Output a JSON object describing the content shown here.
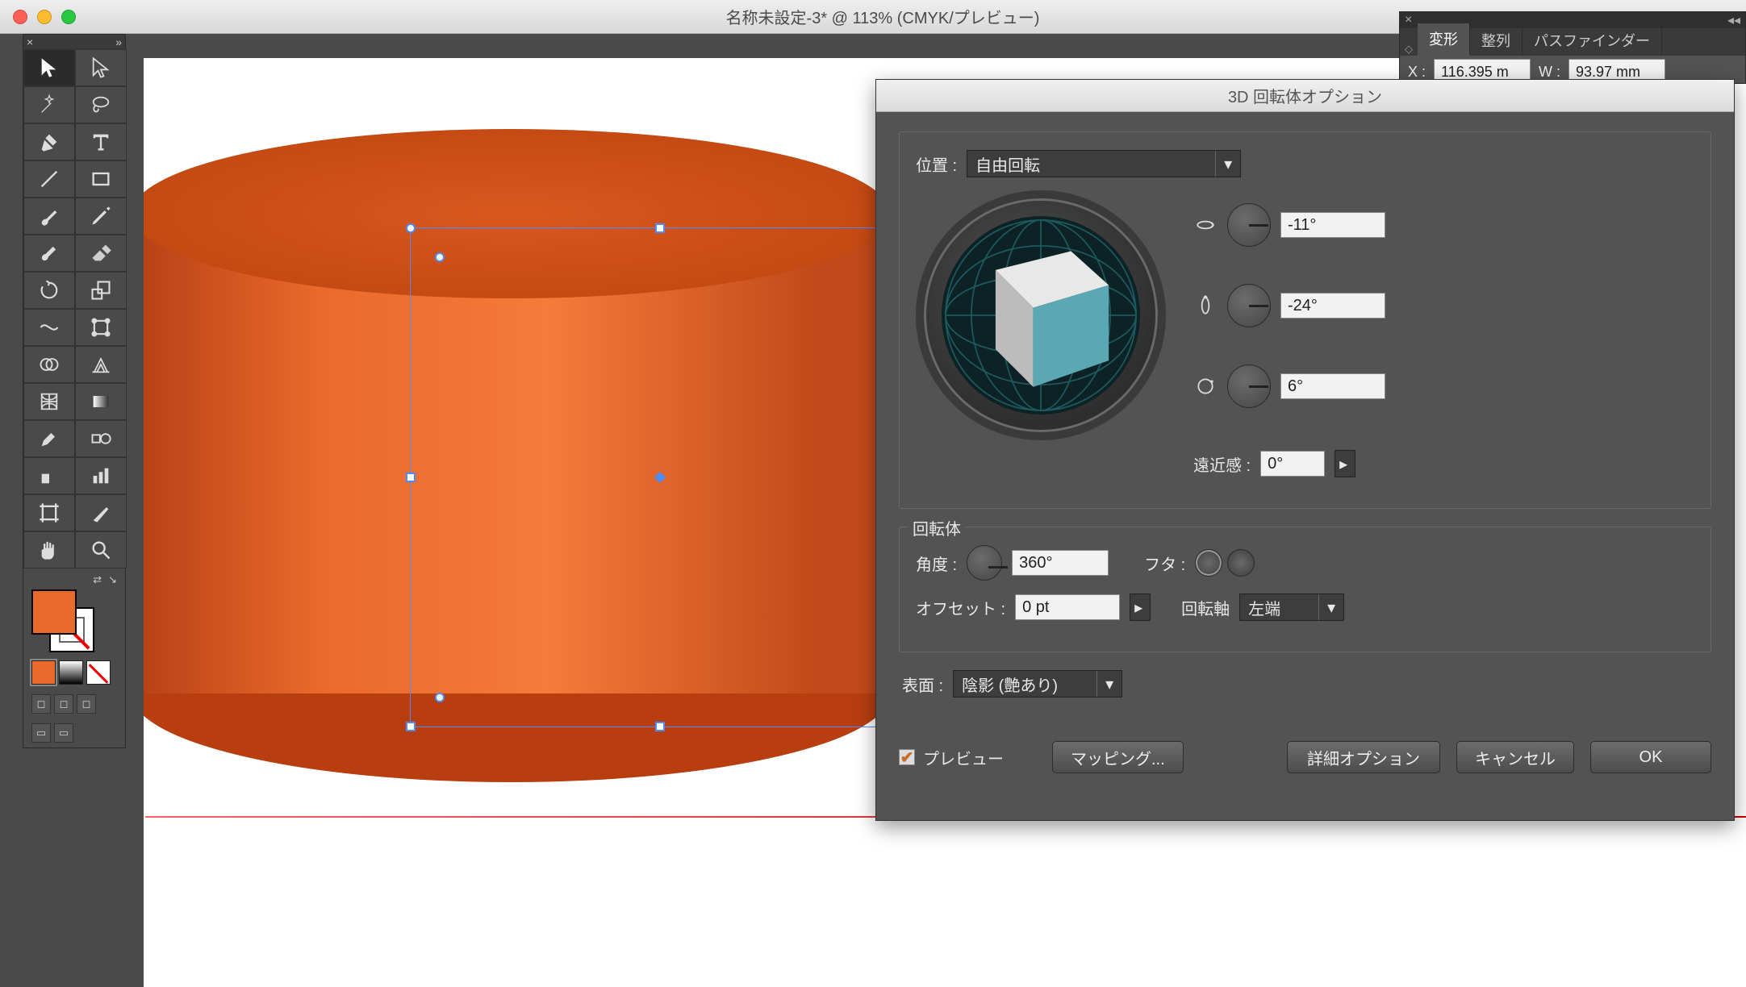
{
  "window": {
    "title": "名称未設定-3* @ 113% (CMYK/プレビュー)"
  },
  "palette": {
    "tabs": {
      "transform": "変形",
      "align": "整列",
      "pathfinder": "パスファインダー"
    },
    "x_label": "X :",
    "x_value": "116.395 m",
    "w_label": "W :",
    "w_value": "93.97 mm"
  },
  "dialog": {
    "title": "3D 回転体オプション",
    "position_label": "位置 :",
    "position_value": "自由回転",
    "rot_x": "-11°",
    "rot_y": "-24°",
    "rot_z": "6°",
    "perspective_label": "遠近感 :",
    "perspective_value": "0°",
    "revolve_legend": "回転体",
    "angle_label": "角度 :",
    "angle_value": "360°",
    "cap_label": "フタ :",
    "offset_label": "オフセット :",
    "offset_value": "0 pt",
    "axis_label": "回転軸",
    "axis_value": "左端",
    "surface_label": "表面 :",
    "surface_value": "陰影 (艶あり)",
    "preview_label": "プレビュー",
    "mapping_btn": "マッピング...",
    "more_btn": "詳細オプション",
    "cancel_btn": "キャンセル",
    "ok_btn": "OK"
  },
  "colors": {
    "fill": "#e96a2b"
  }
}
